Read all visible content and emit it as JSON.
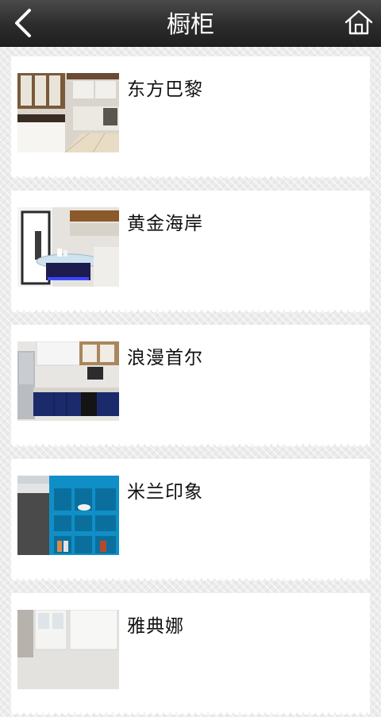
{
  "header": {
    "title": "橱柜",
    "back_icon": "chevron-left-icon",
    "home_icon": "home-icon"
  },
  "colors": {
    "header_bg": "#2e2e2e",
    "page_bg": "#ececec",
    "card_bg": "#ffffff",
    "text": "#111111"
  },
  "items": [
    {
      "title": "东方巴黎"
    },
    {
      "title": "黄金海岸"
    },
    {
      "title": "浪漫首尔"
    },
    {
      "title": "米兰印象"
    },
    {
      "title": "雅典娜"
    }
  ]
}
